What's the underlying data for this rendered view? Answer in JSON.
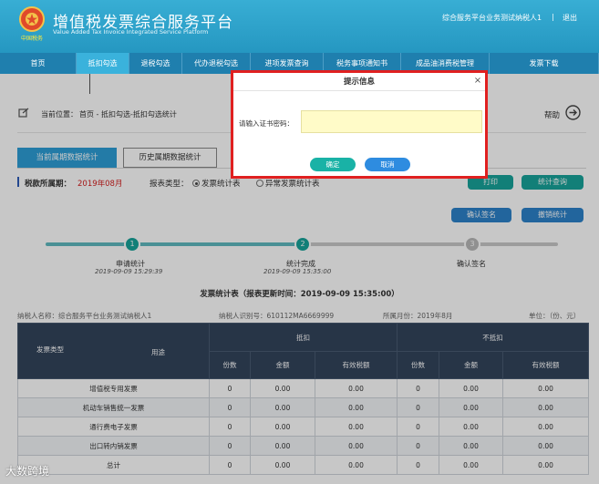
{
  "header": {
    "title_zh": "增值税发票综合服务平台",
    "title_en": "Value Added Tax Invoice Integrated Service Platform",
    "user": "综合服务平台业务测试纳税人1",
    "separator": "|",
    "exit": "退出",
    "logo_text": "中国税务"
  },
  "nav": {
    "items": [
      {
        "label": "首页",
        "w": 84
      },
      {
        "label": "抵扣勾选",
        "w": 58
      },
      {
        "label": "退税勾选",
        "w": 58
      },
      {
        "label": "代办退税勾选",
        "w": 75
      },
      {
        "label": "进项发票查询",
        "w": 80
      },
      {
        "label": "税务事项通知书",
        "w": 85
      },
      {
        "label": "成品油消费税管理",
        "w": 97
      },
      {
        "label": "发票下载",
        "w": 120
      }
    ],
    "active_index": 1
  },
  "breadcrumb": {
    "label": "当前位置：",
    "path": "首页 - 抵扣勾选-抵扣勾选统计",
    "help": "帮助"
  },
  "tabs": {
    "current": "当前属期数据统计",
    "history": "历史属期数据统计"
  },
  "period": {
    "label": "税款所属期：",
    "value": "2019年08月",
    "report_type_label": "报表类型：",
    "option_1": "发票统计表",
    "option_2": "异常发票统计表"
  },
  "buttons": {
    "print": "打印",
    "query": "统计查询",
    "confirm_sign": "确认签名",
    "cancel_stat": "撤销统计"
  },
  "progress": {
    "steps": [
      {
        "num": "1",
        "title": "申请统计",
        "date": "2019-09-09 15:29:39"
      },
      {
        "num": "2",
        "title": "统计完成",
        "date": "2019-09-09 15:35:00"
      },
      {
        "num": "3",
        "title": "确认签名",
        "date": ""
      }
    ]
  },
  "stat": {
    "title": "发票统计表（报表更新时间：2019-09-09 15:35:00）",
    "taxpayer": "纳税人名称：综合服务平台业务测试纳税人1",
    "tax_id": "纳税人识别号：610112MA6669999",
    "period": "所属月份：2019年8月",
    "unit": "单位：（份、元）"
  },
  "table": {
    "corner_type": "发票类型",
    "corner_use": "用途",
    "group_deduct": "抵扣",
    "group_nondeduct": "不抵扣",
    "sub_headers": [
      "份数",
      "金额",
      "有效税额",
      "份数",
      "金额",
      "有效税额"
    ],
    "rows": [
      {
        "name": "增值税专用发票",
        "cells": [
          "0",
          "0.00",
          "0.00",
          "0",
          "0.00",
          "0.00"
        ]
      },
      {
        "name": "机动车销售统一发票",
        "cells": [
          "0",
          "0.00",
          "0.00",
          "0",
          "0.00",
          "0.00"
        ]
      },
      {
        "name": "通行费电子发票",
        "cells": [
          "0",
          "0.00",
          "0.00",
          "0",
          "0.00",
          "0.00"
        ]
      },
      {
        "name": "出口转内销发票",
        "cells": [
          "0",
          "0.00",
          "0.00",
          "0",
          "0.00",
          "0.00"
        ]
      },
      {
        "name": "总计",
        "cells": [
          "0",
          "0.00",
          "0.00",
          "0",
          "0.00",
          "0.00"
        ]
      }
    ]
  },
  "dialog": {
    "title": "提示信息",
    "close": "×",
    "label": "请输入证书密码：",
    "input_value": "",
    "ok": "确定",
    "cancel": "取消"
  },
  "watermark": "大数跨境",
  "colors": {
    "header_bg": "#2ea3c9",
    "nav_bg": "#1f7fae",
    "nav_active": "#3ab2dc",
    "teal": "#18a39a",
    "blue": "#2c82c9",
    "highlight_border": "#e02020",
    "table_header": "#33445c",
    "period_red": "#d42020"
  }
}
